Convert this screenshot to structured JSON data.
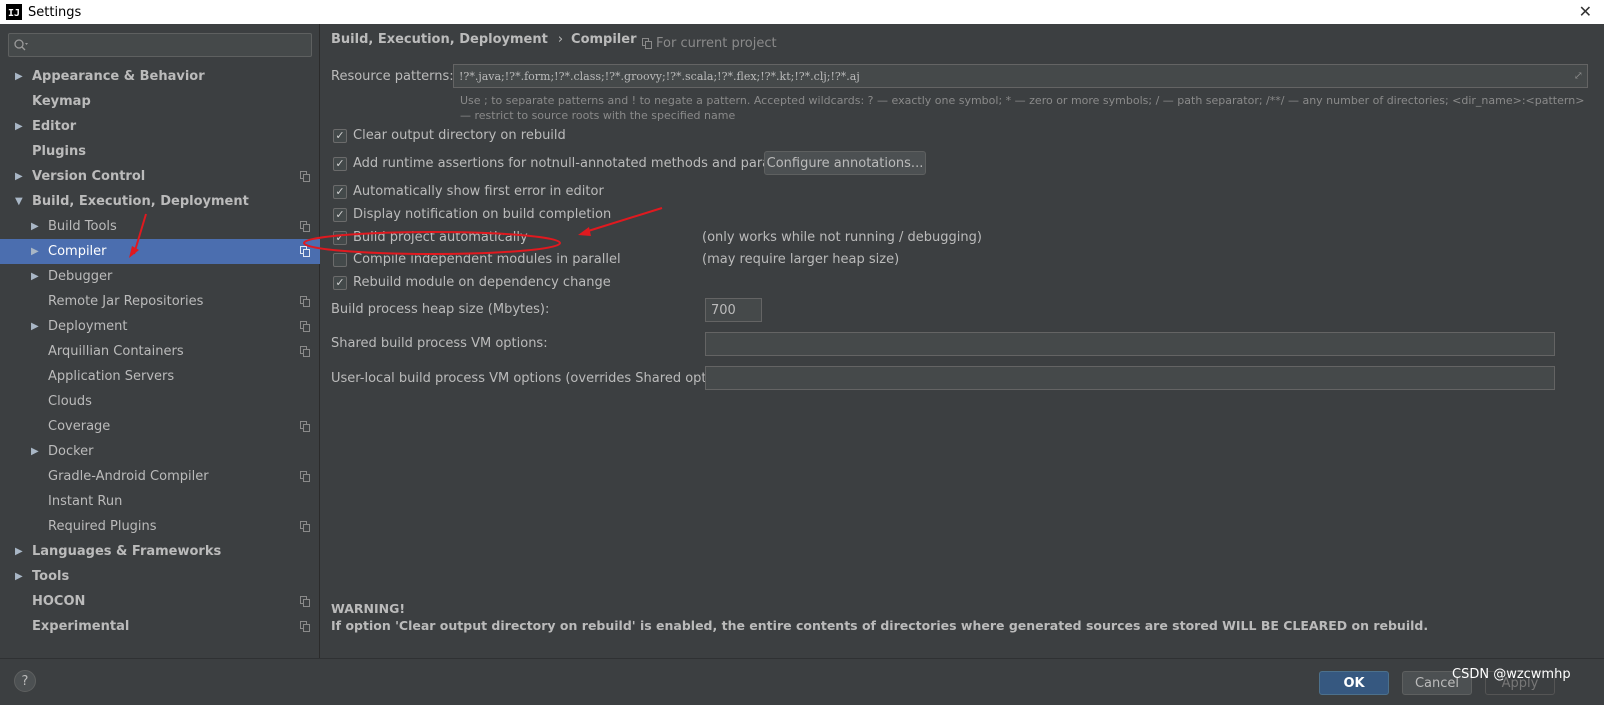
{
  "window": {
    "title": "Settings",
    "app_icon": "IJ"
  },
  "sidebar": {
    "search_placeholder": "",
    "items": [
      {
        "label": "Appearance & Behavior",
        "level": 0,
        "bold": true,
        "expandable": true,
        "expanded": false,
        "project_icon": false,
        "selected": false
      },
      {
        "label": "Keymap",
        "level": 0,
        "bold": true,
        "expandable": false,
        "expanded": false,
        "project_icon": false,
        "selected": false
      },
      {
        "label": "Editor",
        "level": 0,
        "bold": true,
        "expandable": true,
        "expanded": false,
        "project_icon": false,
        "selected": false
      },
      {
        "label": "Plugins",
        "level": 0,
        "bold": true,
        "expandable": false,
        "expanded": false,
        "project_icon": false,
        "selected": false
      },
      {
        "label": "Version Control",
        "level": 0,
        "bold": true,
        "expandable": true,
        "expanded": false,
        "project_icon": true,
        "selected": false
      },
      {
        "label": "Build, Execution, Deployment",
        "level": 0,
        "bold": true,
        "expandable": true,
        "expanded": true,
        "project_icon": false,
        "selected": false
      },
      {
        "label": "Build Tools",
        "level": 1,
        "bold": false,
        "expandable": true,
        "expanded": false,
        "project_icon": true,
        "selected": false
      },
      {
        "label": "Compiler",
        "level": 1,
        "bold": false,
        "expandable": true,
        "expanded": false,
        "project_icon": true,
        "selected": true
      },
      {
        "label": "Debugger",
        "level": 1,
        "bold": false,
        "expandable": true,
        "expanded": false,
        "project_icon": false,
        "selected": false
      },
      {
        "label": "Remote Jar Repositories",
        "level": 1,
        "bold": false,
        "expandable": false,
        "expanded": false,
        "project_icon": true,
        "selected": false
      },
      {
        "label": "Deployment",
        "level": 1,
        "bold": false,
        "expandable": true,
        "expanded": false,
        "project_icon": true,
        "selected": false
      },
      {
        "label": "Arquillian Containers",
        "level": 1,
        "bold": false,
        "expandable": false,
        "expanded": false,
        "project_icon": true,
        "selected": false
      },
      {
        "label": "Application Servers",
        "level": 1,
        "bold": false,
        "expandable": false,
        "expanded": false,
        "project_icon": false,
        "selected": false
      },
      {
        "label": "Clouds",
        "level": 1,
        "bold": false,
        "expandable": false,
        "expanded": false,
        "project_icon": false,
        "selected": false
      },
      {
        "label": "Coverage",
        "level": 1,
        "bold": false,
        "expandable": false,
        "expanded": false,
        "project_icon": true,
        "selected": false
      },
      {
        "label": "Docker",
        "level": 1,
        "bold": false,
        "expandable": true,
        "expanded": false,
        "project_icon": false,
        "selected": false
      },
      {
        "label": "Gradle-Android Compiler",
        "level": 1,
        "bold": false,
        "expandable": false,
        "expanded": false,
        "project_icon": true,
        "selected": false
      },
      {
        "label": "Instant Run",
        "level": 1,
        "bold": false,
        "expandable": false,
        "expanded": false,
        "project_icon": false,
        "selected": false
      },
      {
        "label": "Required Plugins",
        "level": 1,
        "bold": false,
        "expandable": false,
        "expanded": false,
        "project_icon": true,
        "selected": false
      },
      {
        "label": "Languages & Frameworks",
        "level": 0,
        "bold": true,
        "expandable": true,
        "expanded": false,
        "project_icon": false,
        "selected": false
      },
      {
        "label": "Tools",
        "level": 0,
        "bold": true,
        "expandable": true,
        "expanded": false,
        "project_icon": false,
        "selected": false
      },
      {
        "label": "HOCON",
        "level": 0,
        "bold": true,
        "expandable": false,
        "expanded": false,
        "project_icon": true,
        "selected": false
      },
      {
        "label": "Experimental",
        "level": 0,
        "bold": true,
        "expandable": false,
        "expanded": false,
        "project_icon": true,
        "selected": false
      }
    ]
  },
  "main": {
    "breadcrumb": {
      "parent": "Build, Execution, Deployment",
      "separator": "›",
      "current": "Compiler"
    },
    "for_current_project": "For current project",
    "resource_patterns": {
      "label": "Resource patterns:",
      "value": "!?*.java;!?*.form;!?*.class;!?*.groovy;!?*.scala;!?*.flex;!?*.kt;!?*.clj;!?*.aj",
      "hint": "Use ; to separate patterns and ! to negate a pattern. Accepted wildcards: ? — exactly one symbol; * — zero or more symbols; / — path separator; /**/ — any number of directories; <dir_name>:<pattern> — restrict to source roots with the specified name"
    },
    "options": [
      {
        "label": "Clear output directory on rebuild",
        "checked": true,
        "note": ""
      },
      {
        "label": "Add runtime assertions for notnull-annotated methods and parameters",
        "checked": true,
        "note": ""
      },
      {
        "label": "Automatically show first error in editor",
        "checked": true,
        "note": ""
      },
      {
        "label": "Display notification on build completion",
        "checked": true,
        "note": ""
      },
      {
        "label": "Build project automatically",
        "checked": true,
        "note": "(only works while not running / debugging)"
      },
      {
        "label": "Compile independent modules in parallel",
        "checked": false,
        "note": "(may require larger heap size)"
      },
      {
        "label": "Rebuild module on dependency change",
        "checked": true,
        "note": ""
      }
    ],
    "configure_annotations_button": "Configure annotations...",
    "heap_size": {
      "label": "Build process heap size (Mbytes):",
      "value": "700"
    },
    "shared_vm": {
      "label": "Shared build process VM options:",
      "value": ""
    },
    "user_vm": {
      "label": "User-local build process VM options (overrides Shared options):",
      "value": ""
    },
    "warning": {
      "title": "WARNING!",
      "text": "If option 'Clear output directory on rebuild' is enabled, the entire contents of directories where generated sources are stored WILL BE CLEARED on rebuild."
    }
  },
  "footer": {
    "help": "?",
    "ok": "OK",
    "cancel": "Cancel",
    "apply": "Apply",
    "watermark": "CSDN @wzcwmhp"
  },
  "colors": {
    "background": "#3c3f41",
    "selection": "#4b6eaf",
    "ok_button": "#365880",
    "annotation": "#e0191f"
  }
}
